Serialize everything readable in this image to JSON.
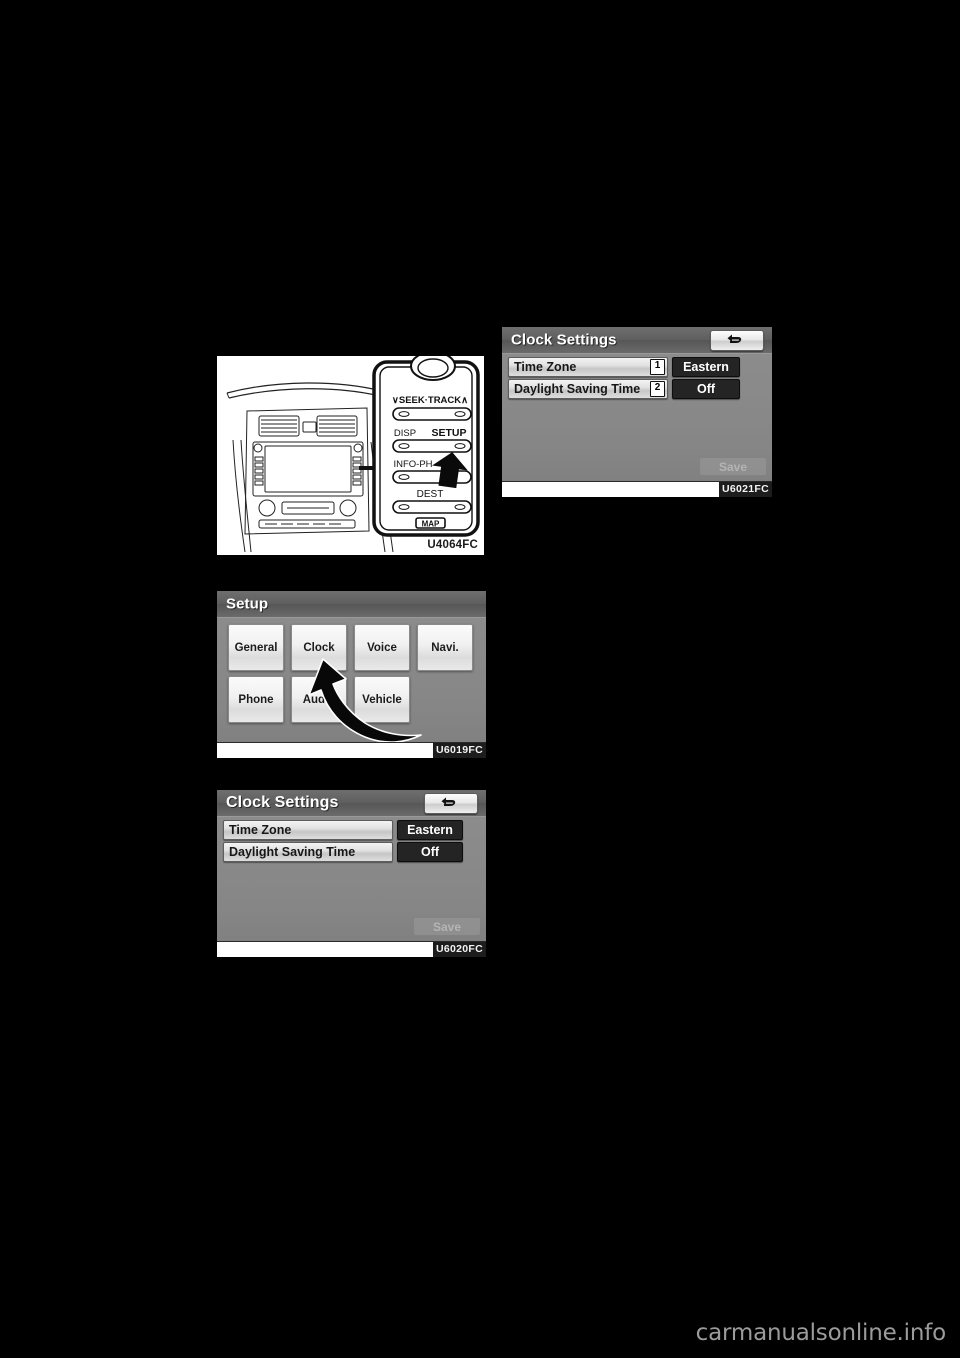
{
  "page": {
    "background_color": "#000000",
    "watermark": "carmanualsonline.info"
  },
  "figures": {
    "dashboard": {
      "code": "U4064FC",
      "button_labels": {
        "seek_track": "SEEK·TRACK",
        "disp": "DISP",
        "setup": "SETUP",
        "info_phone": "INFO-PH",
        "dest": "DEST",
        "map": "MAP",
        "seek_left": "∨",
        "seek_right": "∧"
      }
    },
    "clock_settings_callout": {
      "code": "U6021FC",
      "title": "Clock Settings",
      "back_icon": "back-arrow-icon",
      "rows": [
        {
          "label": "Time Zone",
          "callout": "1",
          "value": "Eastern"
        },
        {
          "label": "Daylight Saving Time",
          "callout": "2",
          "value": "Off"
        }
      ],
      "save_label": "Save"
    },
    "setup": {
      "code": "U6019FC",
      "title": "Setup",
      "buttons": [
        "General",
        "Clock",
        "Voice",
        "Navi.",
        "Phone",
        "Audio",
        "Vehicle"
      ],
      "cursor": "hand-pointer-arrow"
    },
    "clock_settings_plain": {
      "code": "U6020FC",
      "title": "Clock Settings",
      "back_icon": "back-arrow-icon",
      "rows": [
        {
          "label": "Time Zone",
          "value": "Eastern"
        },
        {
          "label": "Daylight Saving Time",
          "value": "Off"
        }
      ],
      "save_label": "Save"
    }
  }
}
